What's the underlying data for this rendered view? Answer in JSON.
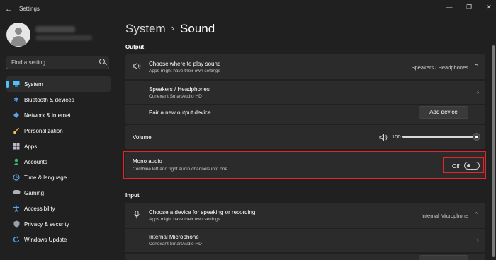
{
  "app": {
    "title": "Settings"
  },
  "sidebar": {
    "search_placeholder": "Find a setting",
    "items": [
      {
        "label": "System",
        "icon": "monitor-icon",
        "active": true
      },
      {
        "label": "Bluetooth & devices",
        "icon": "bluetooth-icon"
      },
      {
        "label": "Network & internet",
        "icon": "network-icon"
      },
      {
        "label": "Personalization",
        "icon": "brush-icon"
      },
      {
        "label": "Apps",
        "icon": "apps-icon"
      },
      {
        "label": "Accounts",
        "icon": "accounts-icon"
      },
      {
        "label": "Time & language",
        "icon": "globe-clock-icon"
      },
      {
        "label": "Gaming",
        "icon": "gamepad-icon"
      },
      {
        "label": "Accessibility",
        "icon": "accessibility-icon"
      },
      {
        "label": "Privacy & security",
        "icon": "shield-icon"
      },
      {
        "label": "Windows Update",
        "icon": "update-icon"
      }
    ]
  },
  "breadcrumb": {
    "parent": "System",
    "separator": "›",
    "current": "Sound"
  },
  "output": {
    "section_label": "Output",
    "choose": {
      "title": "Choose where to play sound",
      "subtitle": "Apps might have their own settings",
      "value": "Speakers / Headphones"
    },
    "device": {
      "title": "Speakers / Headphones",
      "subtitle": "Conexant SmartAudio HD"
    },
    "pair": {
      "title": "Pair a new output device",
      "button": "Add device"
    },
    "volume": {
      "title": "Volume",
      "value": "100",
      "level": 1.0
    },
    "mono": {
      "title": "Mono audio",
      "subtitle": "Combine left and right audio channels into one",
      "state": "Off",
      "on": false
    }
  },
  "input": {
    "section_label": "Input",
    "choose": {
      "title": "Choose a device for speaking or recording",
      "subtitle": "Apps might have their own settings",
      "value": "Internal Microphone"
    },
    "device": {
      "title": "Internal Microphone",
      "subtitle": "Conexant SmartAudio HD"
    }
  },
  "colors": {
    "accent": "#4cc2ff",
    "highlight": "#e8242b",
    "background": "#202020",
    "card": "#2b2b2b"
  }
}
